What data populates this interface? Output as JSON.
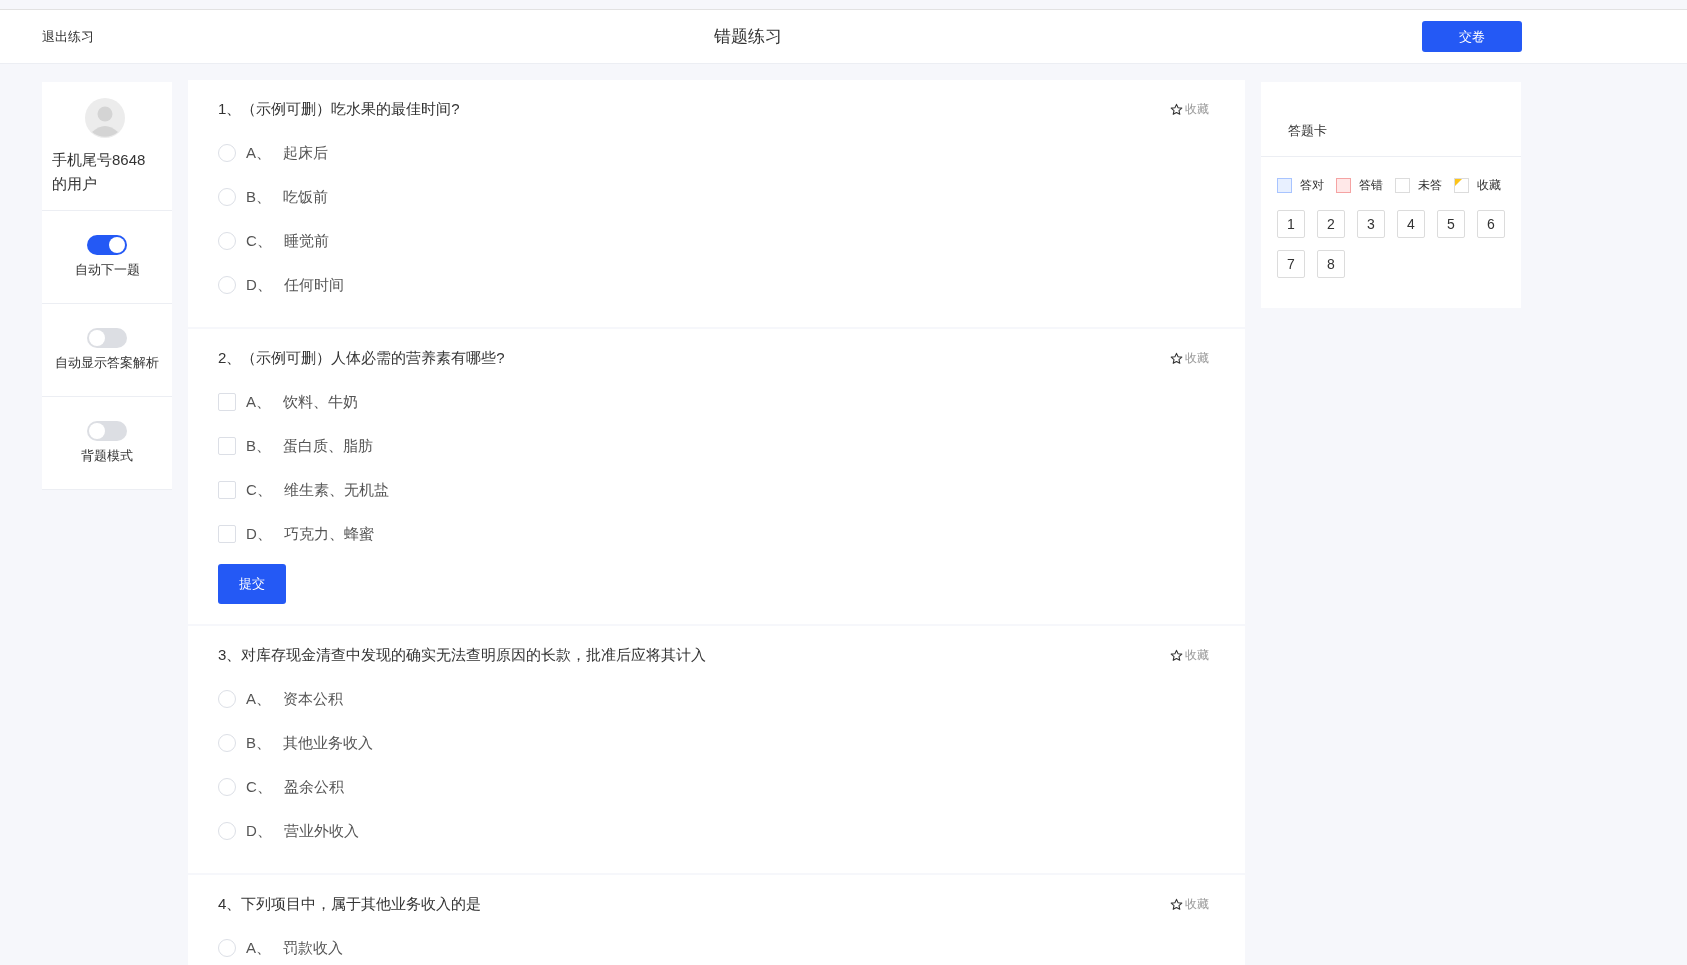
{
  "header": {
    "exit_link": "退出练习",
    "title": "错题练习",
    "submit_button": "交卷"
  },
  "profile": {
    "user_name": "手机尾号8648的用户"
  },
  "settings": [
    {
      "label": "自动下一题",
      "on": true
    },
    {
      "label": "自动显示答案解析",
      "on": false
    },
    {
      "label": "背题模式",
      "on": false
    }
  ],
  "questions": [
    {
      "kind": "single",
      "title": "1、（示例可删）吃水果的最佳时间?",
      "favorite_label": "收藏",
      "options": [
        {
          "letter": "A、",
          "text": "起床后",
          "checked": false
        },
        {
          "letter": "B、",
          "text": "吃饭前",
          "checked": false
        },
        {
          "letter": "C、",
          "text": "睡觉前",
          "checked": false
        },
        {
          "letter": "D、",
          "text": "任何时间",
          "checked": false
        }
      ]
    },
    {
      "kind": "multiple",
      "title": "2、（示例可删）人体必需的营养素有哪些?",
      "favorite_label": "收藏",
      "options": [
        {
          "letter": "A、",
          "text": "饮料、牛奶",
          "checked": false
        },
        {
          "letter": "B、",
          "text": "蛋白质、脂肪",
          "checked": false
        },
        {
          "letter": "C、",
          "text": "维生素、无机盐",
          "checked": false
        },
        {
          "letter": "D、",
          "text": "巧克力、蜂蜜",
          "checked": false
        }
      ],
      "submit_button": "提交"
    },
    {
      "kind": "single",
      "title": "3、对库存现金清查中发现的确实无法查明原因的长款，批准后应将其计入",
      "favorite_label": "收藏",
      "options": [
        {
          "letter": "A、",
          "text": "资本公积",
          "checked": false
        },
        {
          "letter": "B、",
          "text": "其他业务收入",
          "checked": false
        },
        {
          "letter": "C、",
          "text": "盈余公积",
          "checked": false
        },
        {
          "letter": "D、",
          "text": "营业外收入",
          "checked": false
        }
      ]
    },
    {
      "kind": "single",
      "title": "4、下列项目中，属于其他业务收入的是",
      "favorite_label": "收藏",
      "options": [
        {
          "letter": "A、",
          "text": "罚款收入",
          "checked": false
        }
      ]
    }
  ],
  "answer_card": {
    "title": "答题卡",
    "legend": [
      {
        "kind": "correct",
        "label": "答对"
      },
      {
        "kind": "wrong",
        "label": "答错"
      },
      {
        "kind": "unanswered",
        "label": "未答"
      },
      {
        "kind": "favorite",
        "label": "收藏"
      }
    ],
    "numbers": [
      "1",
      "2",
      "3",
      "4",
      "5",
      "6",
      "7",
      "8"
    ]
  }
}
